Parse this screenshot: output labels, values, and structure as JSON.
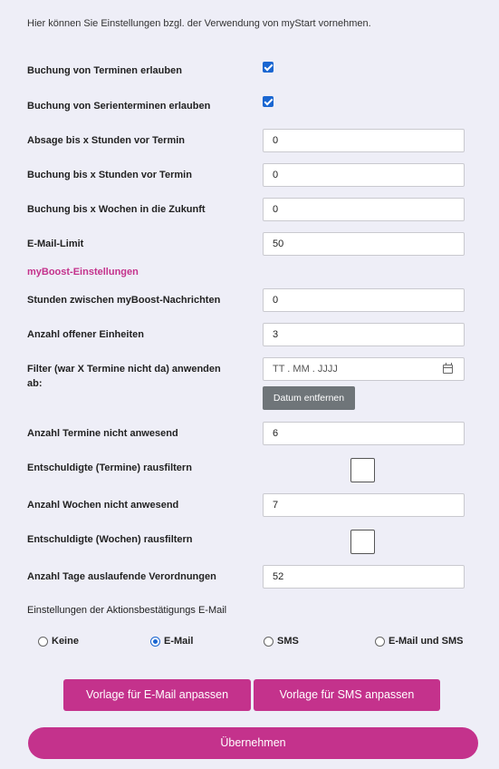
{
  "intro": "Hier können Sie Einstellungen bzgl. der Verwendung von myStart vornehmen.",
  "settings": {
    "booking_label": "Buchung von Terminen erlauben",
    "booking_checked": true,
    "series_label": "Buchung von Serienterminen erlauben",
    "series_checked": true,
    "cancel_label": "Absage bis x Stunden vor Termin",
    "cancel_value": "0",
    "book_hours_label": "Buchung bis x Stunden vor Termin",
    "book_hours_value": "0",
    "book_weeks_label": "Buchung bis x Wochen in die Zukunft",
    "book_weeks_value": "0",
    "email_limit_label": "E-Mail-Limit",
    "email_limit_value": "50"
  },
  "myboost": {
    "title": "myBoost-Einstellungen",
    "hours_label": "Stunden zwischen myBoost-Nachrichten",
    "hours_value": "0",
    "open_units_label": "Anzahl offener Einheiten",
    "open_units_value": "3",
    "filter_label": "Filter (war X Termine nicht da) anwenden ab:",
    "filter_date_placeholder": "TT . MM . JJJJ",
    "remove_date_button": "Datum entfernen",
    "absent_appts_label": "Anzahl Termine nicht anwesend",
    "absent_appts_value": "6",
    "excused_appts_label": "Entschuldigte (Termine) rausfiltern",
    "excused_appts_checked": false,
    "absent_weeks_label": "Anzahl Wochen nicht anwesend",
    "absent_weeks_value": "7",
    "excused_weeks_label": "Entschuldigte (Wochen) rausfiltern",
    "excused_weeks_checked": false,
    "expiring_days_label": "Anzahl Tage auslaufende Verordnungen",
    "expiring_days_value": "52"
  },
  "confirmation": {
    "label": "Einstellungen der Aktionsbestätigungs E-Mail",
    "options": [
      "Keine",
      "E-Mail",
      "SMS",
      "E-Mail und SMS"
    ],
    "selected": "E-Mail"
  },
  "buttons": {
    "email_template": "Vorlage für E-Mail anpassen",
    "sms_template": "Vorlage für SMS anpassen",
    "submit": "Übernehmen"
  },
  "colors": {
    "accent": "#c4328c",
    "background": "#eeeef7",
    "checkbox": "#1a66d1",
    "secondary_button": "#6f7579"
  }
}
